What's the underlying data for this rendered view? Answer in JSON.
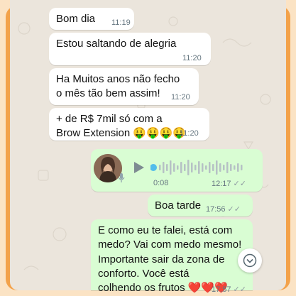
{
  "messages": [
    {
      "text": "Bom dia",
      "time": "11:19"
    },
    {
      "text": "Estou saltando de alegria",
      "time": "11:20"
    },
    {
      "line1": "Ha Muitos anos não fecho",
      "line2": "o mês tão bem assim!",
      "time": "11:20"
    },
    {
      "line1": "+ de R$ 7mil só com a",
      "line2": "Brow Extension 🤑🤑🤑🤑",
      "time": "11:20"
    }
  ],
  "voice_note": {
    "duration": "0:08",
    "time": "12:17",
    "ticks": "✓✓"
  },
  "sent": [
    {
      "text": "Boa tarde",
      "time": "17:56",
      "ticks": "✓✓"
    },
    {
      "lines": [
        "E como eu te falei, está com",
        "medo? Vai com medo mesmo!",
        "Importante sair da zona de",
        "conforto. Você está",
        "colhendo os frutos ❤️❤️❤️"
      ],
      "time": "17:57",
      "ticks": "✓✓"
    }
  ],
  "colors": {
    "frame": "#f3a24a",
    "chat_bg": "#ebe5dc",
    "incoming": "#ffffff",
    "outgoing": "#d9fdd3",
    "accent": "#53bdeb"
  },
  "icons": {
    "play": "play-icon",
    "mic": "microphone-icon",
    "scroll": "chevron-down-icon"
  }
}
